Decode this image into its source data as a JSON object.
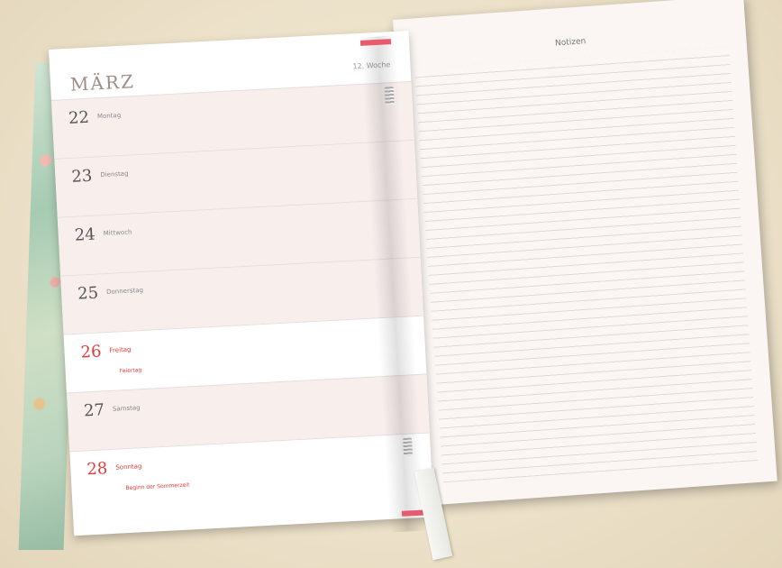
{
  "planner": {
    "month": "MÄRZ",
    "week": "12. Woche",
    "days": [
      {
        "num": "22",
        "name": "Montag"
      },
      {
        "num": "23",
        "name": "Dienstag"
      },
      {
        "num": "24",
        "name": "Mittwoch"
      },
      {
        "num": "25",
        "name": "Donnerstag"
      },
      {
        "num": "26",
        "name": "Freitag",
        "note": "Feiertag"
      },
      {
        "num": "27",
        "name": "Samstag"
      },
      {
        "num": "28",
        "name": "Sonntag",
        "note": "Beginn der Sommerzeit"
      }
    ],
    "notes_title": "Notizen"
  },
  "colors": {
    "accent_red": "#e23b3b",
    "ribbon": "#e85a6e",
    "weekday_bg": "#f8efed",
    "weekend_bg": "#ffffff"
  }
}
